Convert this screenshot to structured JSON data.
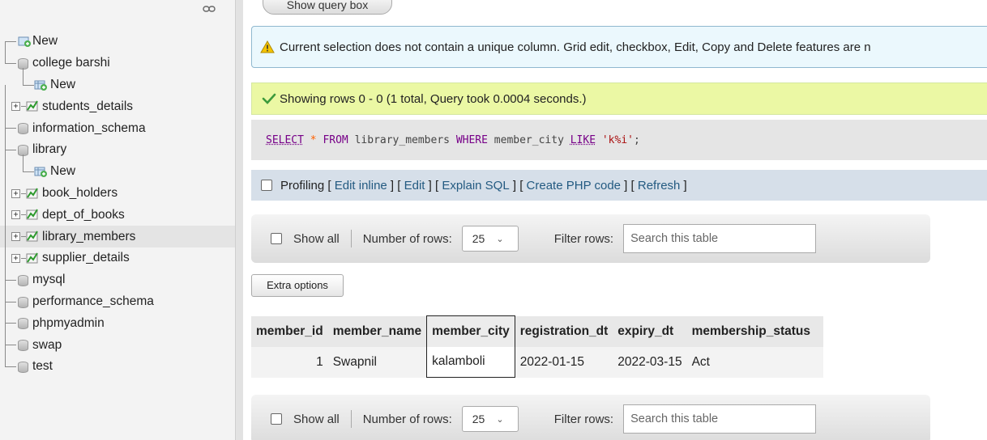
{
  "sidebar": {
    "items": [
      {
        "type": "new",
        "label": "New",
        "level": 0
      },
      {
        "type": "db",
        "label": "college barshi",
        "level": 0
      },
      {
        "type": "new",
        "label": "New",
        "level": 1
      },
      {
        "type": "table",
        "label": "students_details",
        "level": 1
      },
      {
        "type": "db",
        "label": "information_schema",
        "level": 0
      },
      {
        "type": "db",
        "label": "library",
        "level": 0
      },
      {
        "type": "new",
        "label": "New",
        "level": 1
      },
      {
        "type": "table",
        "label": "book_holders",
        "level": 1
      },
      {
        "type": "table",
        "label": "dept_of_books",
        "level": 1
      },
      {
        "type": "table",
        "label": "library_members",
        "level": 1,
        "selected": true
      },
      {
        "type": "table",
        "label": "supplier_details",
        "level": 1
      },
      {
        "type": "db",
        "label": "mysql",
        "level": 0
      },
      {
        "type": "db",
        "label": "performance_schema",
        "level": 0
      },
      {
        "type": "db",
        "label": "phpmyadmin",
        "level": 0
      },
      {
        "type": "db",
        "label": "swap",
        "level": 0
      },
      {
        "type": "db",
        "label": "test",
        "level": 0
      }
    ]
  },
  "main": {
    "query_box_button": "Show query box",
    "notice": "Current selection does not contain a unique column. Grid edit, checkbox, Edit, Copy and Delete features are n",
    "success": "Showing rows 0 - 0 (1 total, Query took 0.0004 seconds.)",
    "sql": {
      "select": "SELECT",
      "star": "*",
      "from": "FROM",
      "table": "library_members",
      "where": "WHERE",
      "column": "member_city",
      "like": "LIKE",
      "pattern": "'k%i'",
      "end": ";"
    },
    "profiling": {
      "label": "Profiling",
      "links": [
        "Edit inline",
        "Edit",
        "Explain SQL",
        "Create PHP code",
        "Refresh"
      ]
    },
    "navbar": {
      "show_all": "Show all",
      "rows_label": "Number of rows:",
      "rows_value": "25",
      "filter_label": "Filter rows:",
      "search_placeholder": "Search this table"
    },
    "extra_options": "Extra options",
    "table": {
      "columns": [
        "member_id",
        "member_name",
        "member_city",
        "registration_dt",
        "expiry_dt",
        "membership_status"
      ],
      "rows": [
        [
          "1",
          "Swapnil",
          "kalamboli",
          "2022-01-15",
          "2022-03-15",
          "Act"
        ]
      ]
    }
  },
  "colors": {
    "notice_bg": "#ebf8fd",
    "success_bg": "#ebf8a4",
    "link": "#235a81",
    "profiling_bg": "#d6dfe9"
  }
}
